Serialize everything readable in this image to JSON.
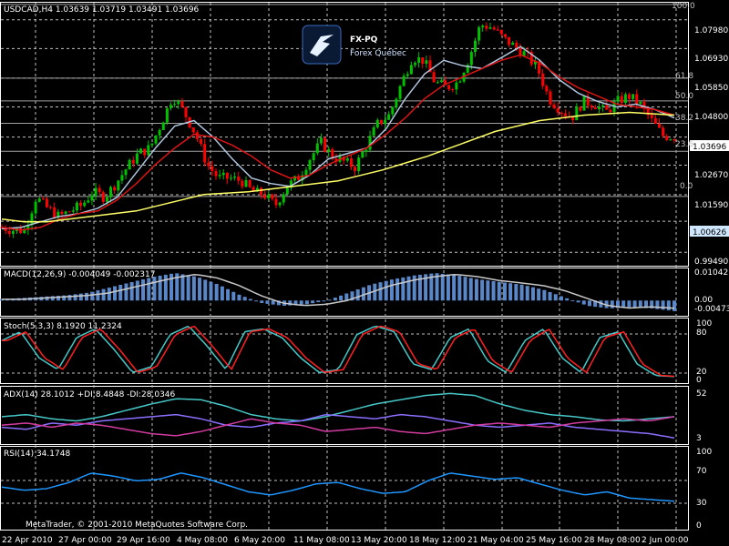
{
  "main": {
    "title": "USDCAD,H4  1.03639 1.03719 1.03491 1.03696",
    "yticks": [
      "1.07980",
      "1.06930",
      "1.05850",
      "1.04800",
      "1.03696",
      "1.02670",
      "1.01590",
      "1.00626",
      "0.99490"
    ],
    "current_price": "1.03696",
    "ma_price": "1.00626"
  },
  "logo": {
    "name": "FX-PQ",
    "tagline": "Forex Québec"
  },
  "fib": {
    "levels": [
      "100.0",
      "61.8",
      "50.0",
      "38.2",
      "23.6",
      "0.0"
    ]
  },
  "macd": {
    "label": "MACD(12,26,9) -0.004049 -0.002317",
    "yticks": [
      "0.01042",
      "0.00",
      "-0.00473"
    ]
  },
  "stoch": {
    "label": "Stoch(5,3,3) 8.1920 11.2324",
    "yticks": [
      "100",
      "80",
      "20",
      "0"
    ]
  },
  "adx": {
    "label": "ADX(14) 28.1012 +DI:8.4848 -DI:28.0346",
    "yticks": [
      "52",
      "3"
    ]
  },
  "rsi": {
    "label": "RSI(14) 34.1748",
    "yticks": [
      "100",
      "70",
      "30",
      "0"
    ]
  },
  "footer": {
    "copyright": "MetaTrader, © 2001-2010 MetaQuotes Software Corp."
  },
  "xaxis": {
    "labels": [
      "22 Apr 2010",
      "27 Apr 00:00",
      "29 Apr 16:00",
      "4 May 08:00",
      "6 May 20:00",
      "11 May 08:00",
      "13 May 20:00",
      "18 May 12:00",
      "21 May 04:00",
      "25 May 16:00",
      "28 May 08:00",
      "2 Jun 00:00"
    ]
  },
  "colors": {
    "background": "#000000",
    "bull": "#00c000",
    "bear": "#ff0000",
    "sma_fast": "#b0c4de",
    "sma_mid": "#dc1414",
    "sma_slow": "#ffff66",
    "macd_hist": "#5a87c8",
    "signal": "#c8c8c8",
    "stoch_main": "#46c8c8",
    "stoch_signal": "#ff2020",
    "adx": "#46c8c8",
    "plus_di": "#8c6eff",
    "minus_di": "#d23ca0",
    "rsi": "#1e96ff"
  },
  "chart_data": {
    "type": "candlestick",
    "symbol": "USDCAD",
    "timeframe": "H4",
    "ohlc_last": {
      "open": 1.03639,
      "high": 1.03719,
      "low": 1.03491,
      "close": 1.03696
    },
    "ylim": [
      0.99,
      1.0857
    ],
    "x": [
      "22 Apr 2010",
      "27 Apr 00:00",
      "29 Apr 16:00",
      "4 May 08:00",
      "6 May 20:00",
      "11 May 08:00",
      "13 May 20:00",
      "18 May 12:00",
      "21 May 04:00",
      "25 May 16:00",
      "28 May 08:00",
      "2 Jun 00:00"
    ],
    "close_path": [
      1.004,
      1.003,
      1.003,
      1.015,
      1.011,
      1.008,
      1.01,
      1.012,
      1.017,
      1.015,
      1.02,
      1.026,
      1.031,
      1.033,
      1.042,
      1.052,
      1.046,
      1.038,
      1.027,
      1.022,
      1.022,
      1.021,
      1.017,
      1.016,
      1.012,
      1.019,
      1.022,
      1.029,
      1.035,
      1.03,
      1.028,
      1.026,
      1.034,
      1.042,
      1.045,
      1.056,
      1.066,
      1.065,
      1.057,
      1.055,
      1.057,
      1.066,
      1.078,
      1.077,
      1.073,
      1.07,
      1.067,
      1.062,
      1.051,
      1.047,
      1.044,
      1.05,
      1.049,
      1.046,
      1.05,
      1.052,
      1.049,
      1.043,
      1.0375,
      1.037
    ],
    "series": [
      {
        "name": "SMA fast",
        "values": [
          1.0035,
          1.004,
          1.006,
          1.008,
          1.009,
          1.011,
          1.015,
          1.024,
          1.033,
          1.041,
          1.043,
          1.037,
          1.029,
          1.022,
          1.02,
          1.019,
          1.023,
          1.029,
          1.031,
          1.033,
          1.04,
          1.051,
          1.06,
          1.065,
          1.063,
          1.062,
          1.066,
          1.07,
          1.065,
          1.058,
          1.053,
          1.05,
          1.048,
          1.049,
          1.047,
          1.044
        ]
      },
      {
        "name": "SMA mid",
        "values": [
          1.004,
          1.003,
          1.004,
          1.007,
          1.009,
          1.01,
          1.014,
          1.02,
          1.027,
          1.033,
          1.038,
          1.037,
          1.034,
          1.03,
          1.025,
          1.022,
          1.023,
          1.027,
          1.03,
          1.033,
          1.038,
          1.044,
          1.051,
          1.056,
          1.059,
          1.062,
          1.065,
          1.067,
          1.064,
          1.059,
          1.055,
          1.052,
          1.049,
          1.048,
          1.047,
          1.045
        ]
      },
      {
        "name": "SMA slow",
        "values": [
          1.007,
          1.006,
          1.006,
          1.007,
          1.008,
          1.009,
          1.01,
          1.012,
          1.014,
          1.016,
          1.0165,
          1.017,
          1.018,
          1.019,
          1.02,
          1.021,
          1.023,
          1.025,
          1.0275,
          1.03,
          1.033,
          1.036,
          1.039,
          1.041,
          1.043,
          1.044,
          1.045,
          1.0455,
          1.046,
          1.0455,
          1.045
        ]
      }
    ],
    "fibonacci": [
      {
        "label": "100.0",
        "price": 1.0854
      },
      {
        "label": "61.8",
        "price": 1.0585
      },
      {
        "label": "50.0",
        "price": 1.0502
      },
      {
        "label": "38.2",
        "price": 1.042
      },
      {
        "label": "23.6",
        "price": 1.0318
      },
      {
        "label": "0.0",
        "price": 1.0153
      }
    ],
    "macd_hist": [
      0.0005,
      0.001,
      0.0015,
      0.002,
      0.003,
      0.005,
      0.007,
      0.009,
      0.0104,
      0.009,
      0.006,
      0.002,
      -0.001,
      -0.002,
      -0.0015,
      0.0,
      0.003,
      0.006,
      0.008,
      0.0095,
      0.0104,
      0.0095,
      0.008,
      0.007,
      0.006,
      0.004,
      0.001,
      -0.002,
      -0.003,
      -0.0025,
      -0.003,
      -0.004
    ],
    "stoch_k": [
      70,
      85,
      40,
      20,
      75,
      90,
      55,
      15,
      25,
      80,
      95,
      60,
      20,
      85,
      90,
      75,
      40,
      15,
      20,
      80,
      95,
      85,
      30,
      20,
      75,
      90,
      35,
      15,
      70,
      90,
      40,
      15,
      75,
      85,
      30,
      10,
      8
    ],
    "adx": [
      28,
      30,
      26,
      24,
      28,
      34,
      40,
      45,
      44,
      38,
      30,
      26,
      24,
      28,
      34,
      40,
      44,
      48,
      50,
      48,
      40,
      34,
      30,
      28,
      25,
      24,
      26,
      28
    ],
    "plus_di": [
      18,
      16,
      22,
      20,
      24,
      26,
      28,
      30,
      26,
      20,
      18,
      22,
      24,
      30,
      28,
      26,
      30,
      28,
      24,
      20,
      18,
      20,
      22,
      18,
      16,
      14,
      12,
      8
    ],
    "minus_di": [
      20,
      22,
      18,
      22,
      20,
      16,
      12,
      10,
      14,
      20,
      26,
      22,
      20,
      14,
      16,
      18,
      14,
      12,
      16,
      20,
      22,
      20,
      18,
      22,
      24,
      26,
      24,
      28
    ],
    "rsi": [
      52,
      48,
      50,
      58,
      70,
      66,
      60,
      62,
      70,
      64,
      55,
      46,
      42,
      48,
      56,
      58,
      50,
      44,
      46,
      60,
      70,
      66,
      62,
      64,
      56,
      48,
      42,
      46,
      38,
      36,
      34
    ]
  }
}
